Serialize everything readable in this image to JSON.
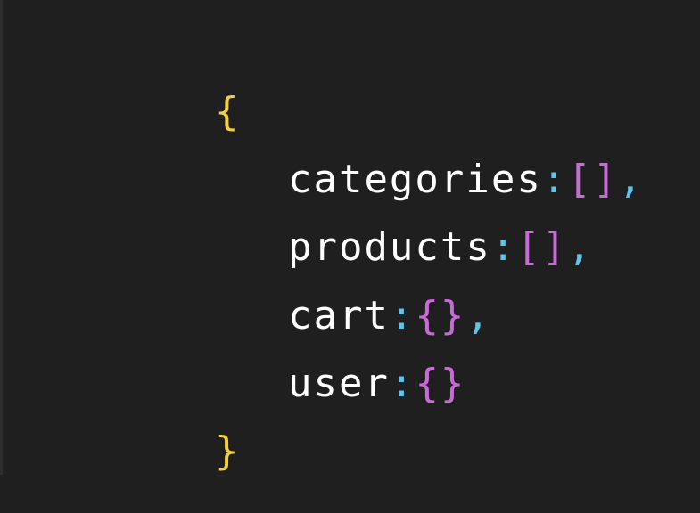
{
  "editor": {
    "colors": {
      "background": "#1f1f1f",
      "outer_brace": "#f2cf4a",
      "key": "#ffffff",
      "punctuation": "#5fc3ec",
      "inner_bracket": "#c86bd8"
    },
    "lines": [
      {
        "open_brace": "{"
      },
      {
        "key": "categories",
        "colon": ":",
        "value": "[]",
        "comma": ","
      },
      {
        "key": "products",
        "colon": ":",
        "value": "[]",
        "comma": ","
      },
      {
        "key": "cart",
        "colon": ":",
        "value": "{}",
        "comma": ","
      },
      {
        "key": "user",
        "colon": ":",
        "value": "{}"
      },
      {
        "close_brace": "}"
      }
    ]
  }
}
